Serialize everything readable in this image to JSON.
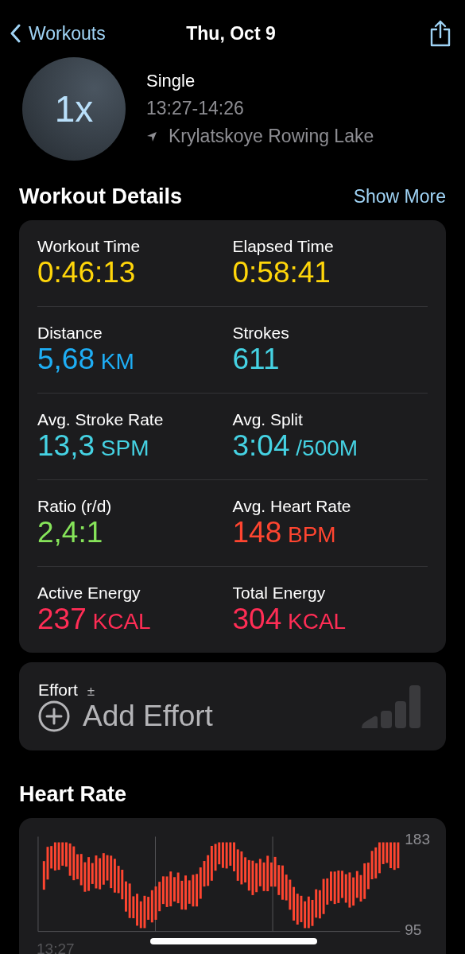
{
  "nav": {
    "back": "Workouts",
    "title": "Thu, Oct 9"
  },
  "workout": {
    "badge": "1x",
    "name": "Single",
    "time": "13:27-14:26",
    "location": "Krylatskoye Rowing Lake"
  },
  "details": {
    "title": "Workout Details",
    "action": "Show More",
    "metrics": [
      {
        "label": "Workout Time",
        "value": "0:46:13",
        "color": "#ffd60a"
      },
      {
        "label": "Elapsed Time",
        "value": "0:58:41",
        "color": "#ffd60a"
      },
      {
        "label": "Distance",
        "value": "5,68",
        "unit": "KM",
        "color": "#1eaef5"
      },
      {
        "label": "Strokes",
        "value": "611",
        "color": "#45d2e3"
      },
      {
        "label": "Avg. Stroke Rate",
        "value": "13,3",
        "unit": "SPM",
        "color": "#45d2e3"
      },
      {
        "label": "Avg. Split",
        "value": "3:04",
        "unit": "/500M",
        "color": "#45d2e3"
      },
      {
        "label": "Ratio (r/d)",
        "value": "2,4:1",
        "color": "#86e45a"
      },
      {
        "label": "Avg. Heart Rate",
        "value": "148",
        "unit": "BPM",
        "color": "#ff4530"
      },
      {
        "label": "Active Energy",
        "value": "237",
        "unit": "KCAL",
        "color": "#ff2d55"
      },
      {
        "label": "Total Energy",
        "value": "304",
        "unit": "KCAL",
        "color": "#ff2d55"
      }
    ]
  },
  "effort": {
    "label": "Effort",
    "symbol": "±",
    "action": "Add Effort"
  },
  "heart_rate": {
    "title": "Heart Rate",
    "y_max": "183",
    "y_min": "95",
    "x_start": "13:27"
  }
}
